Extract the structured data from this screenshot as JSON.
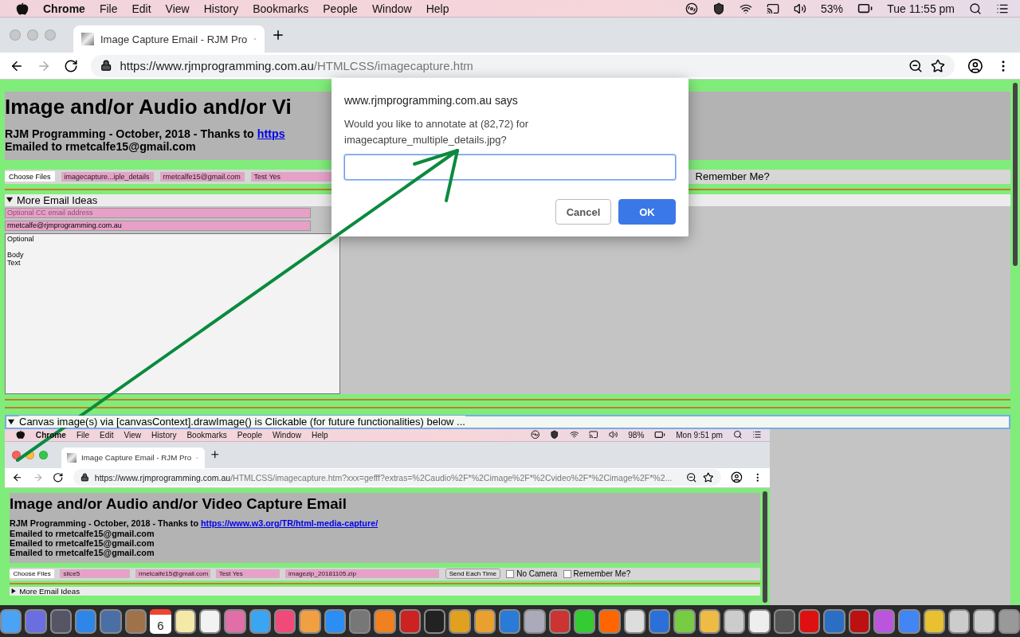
{
  "menu_bar": {
    "app": "Chrome",
    "menus": [
      "File",
      "Edit",
      "View",
      "History",
      "Bookmarks",
      "People",
      "Window",
      "Help"
    ],
    "battery": "53%",
    "clock": "Tue 11:55 pm"
  },
  "browser": {
    "window_active": false,
    "tab_title": "Image Capture Email - RJM Pro",
    "url_host": "https://www.rjmprogramming.com.au",
    "url_path": "/HTMLCSS/imagecapture.htm"
  },
  "page": {
    "title": "Image and/or Audio and/or Vi",
    "byline": "RJM Programming - October, 2018 - Thanks to ",
    "byline_link": "https",
    "emailed": [
      "Emailed to rmetcalfe15@gmail.com"
    ],
    "form": {
      "choose_files": "Choose Files",
      "file_name": "imagecapture...iple_details",
      "email": "rmetcalfe15@gmail.com",
      "subject": "Test Yes",
      "remember_label": "Remember Me?"
    },
    "more_email": {
      "summary": "More Email Ideas",
      "expanded": true,
      "cc_placeholder": "Optional CC email address",
      "from_value": "rmetcalfe@rjmprogramming.com.au",
      "body": "Optional\n\nBody\nText"
    },
    "canvas_section": {
      "summary": "Canvas image(s) via [canvasContext].drawImage() is Clickable (for future functionalities) below ...",
      "expanded": true
    }
  },
  "screenshot": {
    "menu_bar": {
      "app": "Chrome",
      "menus": [
        "File",
        "Edit",
        "View",
        "History",
        "Bookmarks",
        "People",
        "Window",
        "Help"
      ],
      "battery": "98%",
      "clock": "Mon 9:51 pm"
    },
    "browser": {
      "window_active": true,
      "tab_title": "Image Capture Email - RJM Pro",
      "url_host": "https://www.rjmprogramming.com.au",
      "url_path": "/HTMLCSS/imagecapture.htm?xxx=gefff?extras=%2Caudio%2F*%2Cimage%2F*%2Cvideo%2F*%2Cimage%2F*%2..."
    },
    "title": "Image and/or Audio and/or Video Capture Email",
    "byline": "RJM Programming - October, 2018 - Thanks to ",
    "byline_link": "https://www.w3.org/TR/html-media-capture/",
    "emailed": [
      "Emailed to rmetcalfe15@gmail.com",
      "Emailed to rmetcalfe15@gmail.com",
      "Emailed to rmetcalfe15@gmail.com"
    ],
    "form": {
      "choose_files": "Choose Files",
      "file_name": "slice5",
      "email": "rmetcalfe15@gmail.com",
      "subject": "Test Yes",
      "zip": "imagezip_20181105.zip",
      "select": "Send Each Time",
      "checkboxes": [
        {
          "label": "No Camera",
          "checked": false
        },
        {
          "label": "Remember Me?",
          "checked": false
        }
      ]
    },
    "more_email": {
      "summary": "More Email Ideas",
      "expanded": false
    }
  },
  "dialog": {
    "origin": "www.rjmprogramming.com.au says",
    "message": "Would you like to annotate at (82,72) for imagecapture_multiple_details.jpg?",
    "buttons": [
      {
        "label": "Cancel",
        "kind": "secondary"
      },
      {
        "label": "OK",
        "kind": "primary"
      }
    ]
  },
  "dock": {
    "calendar_day": "6"
  }
}
